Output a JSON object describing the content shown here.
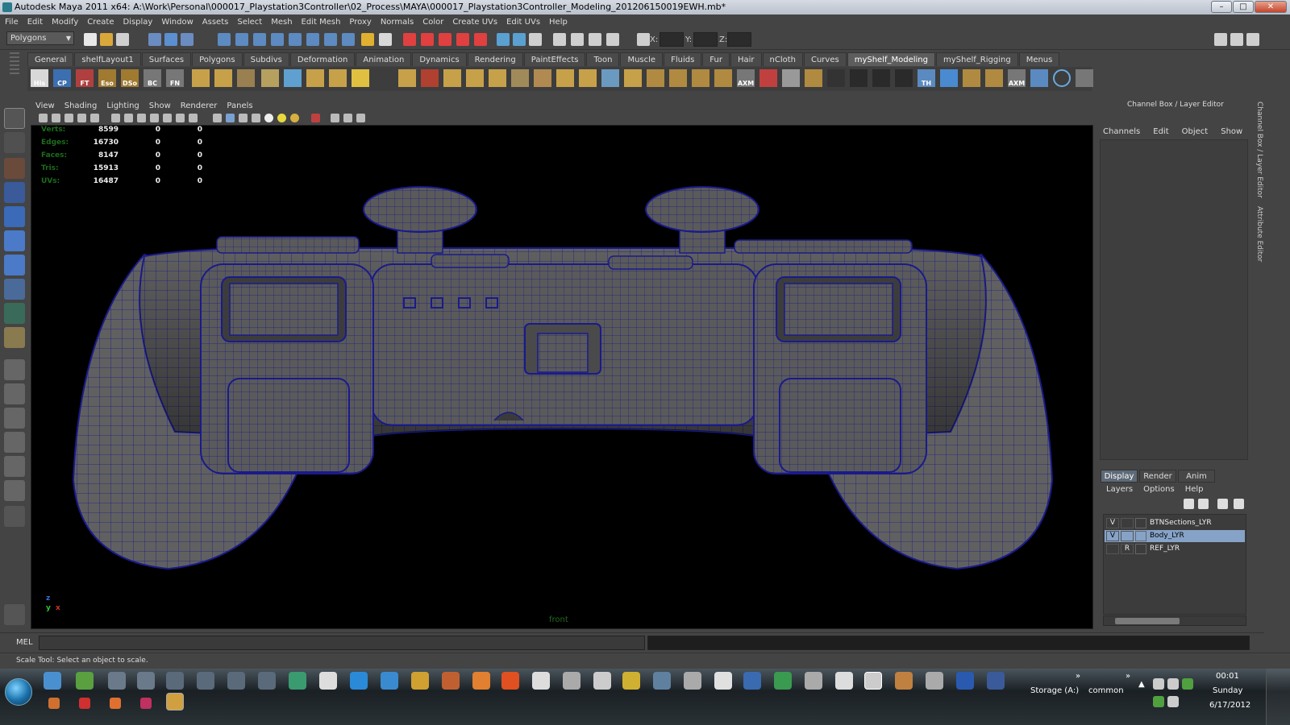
{
  "window": {
    "title": "Autodesk Maya 2011 x64: A:\\Work\\Personal\\000017_Playstation3Controller\\02_Process\\MAYA\\000017_Playstation3Controller_Modeling_201206150019EWH.mb*",
    "minimize": "–",
    "maximize": "□",
    "close": "✕"
  },
  "menubar": [
    "File",
    "Edit",
    "Modify",
    "Create",
    "Display",
    "Window",
    "Assets",
    "Select",
    "Mesh",
    "Edit Mesh",
    "Proxy",
    "Normals",
    "Color",
    "Create UVs",
    "Edit UVs",
    "Help"
  ],
  "statusline": {
    "mode": "Polygons",
    "x_label": "X:",
    "y_label": "Y:",
    "z_label": "Z:"
  },
  "shelf": {
    "tabs": [
      "General",
      "shelfLayout1",
      "Surfaces",
      "Polygons",
      "Subdivs",
      "Deformation",
      "Animation",
      "Dynamics",
      "Rendering",
      "PaintEffects",
      "Toon",
      "Muscle",
      "Fluids",
      "Fur",
      "Hair",
      "nCloth",
      "Curves",
      "myShelf_Modeling",
      "myShelf_Rigging",
      "Menus"
    ],
    "active_tab": "myShelf_Modeling",
    "icons": [
      {
        "name": "his-icon",
        "label": "His",
        "color": "#d8d8d8"
      },
      {
        "name": "cp-icon",
        "label": "CP",
        "color": "#5a9ad8"
      },
      {
        "name": "ft-icon",
        "label": "FT",
        "color": "#d85050"
      },
      {
        "name": "eso-icon",
        "label": "Eso",
        "color": "#c7a14a"
      },
      {
        "name": "dso-icon",
        "label": "DSo",
        "color": "#c7a14a"
      },
      {
        "name": "bc-icon",
        "label": "BC",
        "color": "#bbbbbb"
      },
      {
        "name": "fn-icon",
        "label": "FN",
        "color": "#bbbbbb"
      },
      {
        "name": "axm-icon",
        "label": "AXM",
        "color": "#9a9a9a"
      },
      {
        "name": "th-icon",
        "label": "TH",
        "color": "#8ab4d8"
      },
      {
        "name": "axm2-icon",
        "label": "AXM",
        "color": "#9a9a9a"
      }
    ]
  },
  "viewport": {
    "menu": [
      "View",
      "Shading",
      "Lighting",
      "Show",
      "Renderer",
      "Panels"
    ],
    "camera": "front",
    "hud": [
      {
        "label": "Verts:",
        "values": [
          "8599",
          "0",
          "0"
        ]
      },
      {
        "label": "Edges:",
        "values": [
          "16730",
          "0",
          "0"
        ]
      },
      {
        "label": "Faces:",
        "values": [
          "8147",
          "0",
          "0"
        ]
      },
      {
        "label": "Tris:",
        "values": [
          "15913",
          "0",
          "0"
        ]
      },
      {
        "label": "UVs:",
        "values": [
          "16487",
          "0",
          "0"
        ]
      }
    ],
    "axis": {
      "z": "z",
      "y": "y",
      "x": "x"
    },
    "wire_color": "#1a1a8c",
    "shade_color": "#6a6a6a"
  },
  "right_panel": {
    "title": "Channel Box / Layer Editor",
    "menu": [
      "Channels",
      "Edit",
      "Object",
      "Show"
    ],
    "tabs": [
      "Display",
      "Render",
      "Anim"
    ],
    "active_tab": "Display",
    "layers_menu": [
      "Layers",
      "Options",
      "Help"
    ],
    "layers": [
      {
        "vis": "V",
        "tmpl": "",
        "name": "BTNSections_LYR",
        "selected": false
      },
      {
        "vis": "V",
        "tmpl": "",
        "name": "Body_LYR",
        "selected": true
      },
      {
        "vis": "",
        "tmpl": "R",
        "name": "REF_LYR",
        "selected": false
      }
    ],
    "side_tabs": [
      "Channel Box / Layer Editor",
      "Attribute Editor"
    ]
  },
  "commandline": {
    "label": "MEL"
  },
  "helpline": {
    "text": "Scale Tool: Select an object to scale."
  },
  "taskbar": {
    "storage": "Storage (A:)",
    "folder": "common",
    "time": "00:01",
    "day": "Sunday",
    "date": "6/17/2012"
  }
}
